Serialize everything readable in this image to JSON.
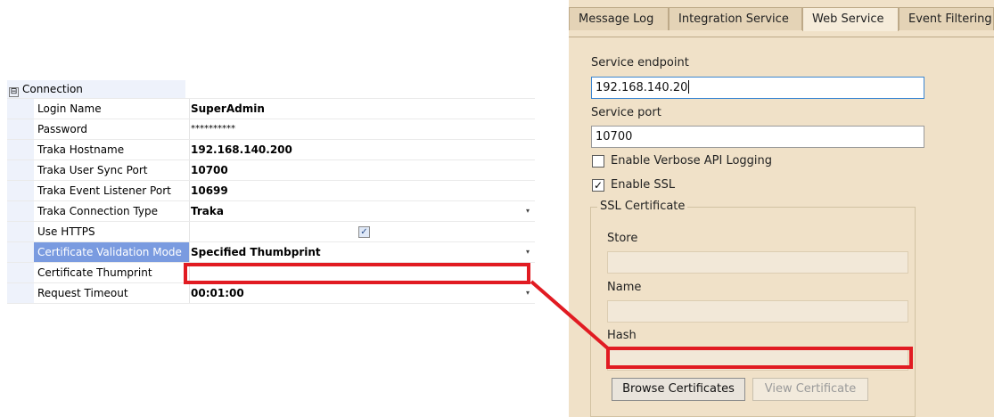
{
  "property_grid": {
    "category": {
      "toggle": "⊟",
      "label": "Connection"
    },
    "rows": [
      {
        "name": "Login Name",
        "value": "SuperAdmin"
      },
      {
        "name": "Password",
        "value": "**********"
      },
      {
        "name": "Traka Hostname",
        "value": "192.168.140.200"
      },
      {
        "name": "Traka User Sync Port",
        "value": "10700"
      },
      {
        "name": "Traka Event Listener Port",
        "value": "10699"
      },
      {
        "name": "Traka Connection Type",
        "value": "Traka"
      },
      {
        "name": "Use HTTPS",
        "value": ""
      },
      {
        "name": "Certificate Validation Mode",
        "value": "Specified Thumbprint"
      },
      {
        "name": "Certificate Thumprint",
        "value": ""
      },
      {
        "name": "Request Timeout",
        "value": "00:01:00"
      }
    ],
    "dropdown_arrow": "▾",
    "use_https_checked": true,
    "check_glyph": "✓"
  },
  "panel": {
    "tabs": [
      "Message Log",
      "Integration Service",
      "Web Service",
      "Event Filtering"
    ],
    "active_tab": "Web Service",
    "service_endpoint_label": "Service endpoint",
    "service_endpoint_value": "192.168.140.20",
    "service_port_label": "Service port",
    "service_port_value": "10700",
    "verbose_logging_label": "Enable Verbose API Logging",
    "verbose_logging_checked": false,
    "enable_ssl_label": "Enable SSL",
    "enable_ssl_checked": true,
    "ssl_group_title": "SSL Certificate",
    "store_label": "Store",
    "name_label": "Name",
    "hash_label": "Hash",
    "browse_button": "Browse Certificates",
    "view_button": "View Certificate"
  },
  "colors": {
    "highlight": "#e11b22",
    "selected_row": "#7a9be0",
    "panel_bg": "#f0e1c8"
  }
}
